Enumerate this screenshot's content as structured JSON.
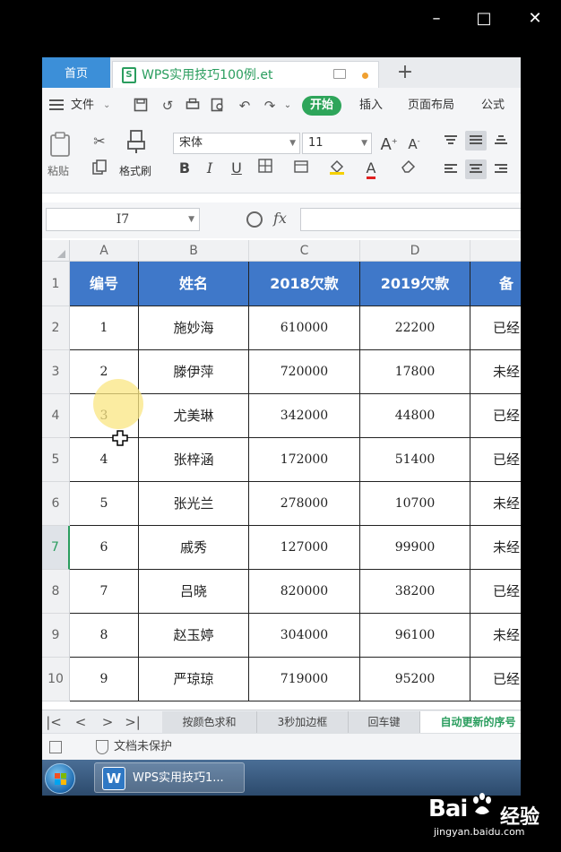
{
  "window": {
    "min_glyph": "–",
    "max_glyph": "□",
    "close_glyph": "✕"
  },
  "tabs": {
    "home_label": "首页",
    "doc_label": "WPS实用技巧100例.et",
    "doc_icon_letter": "S",
    "new_tab_glyph": "+"
  },
  "menu": {
    "file_label": "文件",
    "start_label": "开始",
    "insert_label": "插入",
    "page_layout_label": "页面布局",
    "formula_label": "公式"
  },
  "ribbon": {
    "paste_label": "粘贴",
    "format_painter_label": "格式刷",
    "font_name": "宋体",
    "font_size": "11",
    "bold": "B",
    "italic": "I",
    "underline": "U",
    "font_color_letter": "A",
    "grow_font": "A",
    "shrink_font": "A"
  },
  "formula_bar": {
    "cell_ref": "I7",
    "fx_label": "fx",
    "value": ""
  },
  "grid": {
    "columns": [
      "A",
      "B",
      "C",
      "D"
    ],
    "selected_row": "7",
    "header_row": {
      "row_no": "1",
      "cells": [
        "编号",
        "姓名",
        "2018欠款",
        "2019欠款",
        "备"
      ]
    },
    "rows": [
      {
        "row_no": "2",
        "cells": [
          "1",
          "施妙海",
          "610000",
          "22200",
          "已经"
        ]
      },
      {
        "row_no": "3",
        "cells": [
          "2",
          "滕伊萍",
          "720000",
          "17800",
          "未经"
        ]
      },
      {
        "row_no": "4",
        "cells": [
          "3",
          "尤美琳",
          "342000",
          "44800",
          "已经"
        ]
      },
      {
        "row_no": "5",
        "cells": [
          "4",
          "张梓涵",
          "172000",
          "51400",
          "已经"
        ]
      },
      {
        "row_no": "6",
        "cells": [
          "5",
          "张光兰",
          "278000",
          "10700",
          "未经"
        ]
      },
      {
        "row_no": "7",
        "cells": [
          "6",
          "戚秀",
          "127000",
          "99900",
          "未经"
        ]
      },
      {
        "row_no": "8",
        "cells": [
          "7",
          "吕晓",
          "820000",
          "38200",
          "已经"
        ]
      },
      {
        "row_no": "9",
        "cells": [
          "8",
          "赵玉婷",
          "304000",
          "96100",
          "未经"
        ]
      },
      {
        "row_no": "10",
        "cells": [
          "9",
          "严琼琼",
          "719000",
          "95200",
          "已经"
        ]
      }
    ]
  },
  "sheet_tabs": {
    "nav": [
      "|<",
      "<",
      ">",
      ">|"
    ],
    "tabs": [
      "按颜色求和",
      "3秒加边框",
      "回车键",
      "自动更新的序号"
    ],
    "active": "自动更新的序号"
  },
  "status": {
    "protect_label": "文档未保护"
  },
  "taskbar": {
    "wps_label": "WPS实用技巧1...",
    "wps_icon_letter": "W"
  },
  "watermark": {
    "logo": "Bai",
    "suffix": "经验",
    "url": "jingyan.baidu.com"
  }
}
